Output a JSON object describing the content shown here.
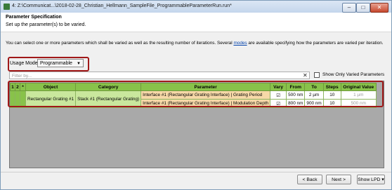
{
  "window": {
    "title": "4: Z:\\Communicat...\\2018-02-28_Christian_Hellmann_SampleFile_ProgrammableParameterRun.run*",
    "controls": {
      "minimize": "–",
      "maximize": "□",
      "close": "✕"
    }
  },
  "header": {
    "title": "Parameter Specification",
    "subtitle": "Set up the parameter(s) to be varied."
  },
  "description": {
    "before": "You can select one or more parameters which shall be varied as well as the resulting number of iterations. Several ",
    "link": "modes",
    "after": " are available specifying how the parameters are varied per iteration."
  },
  "usage_mode": {
    "label": "Usage Mode",
    "value": "Programmable"
  },
  "filter": {
    "placeholder": "Filter by...",
    "clear": "✕"
  },
  "show_only_varied": {
    "label": "Show Only Varied Parameters",
    "checked": false
  },
  "grid": {
    "columns": [
      "1",
      "2",
      "*",
      "Object",
      "Category",
      "Parameter",
      "Vary",
      "From",
      "To",
      "Steps",
      "Original Value"
    ],
    "object": "Rectangular Grating #1",
    "category": "Stack #1 (Rectangular Grating)",
    "rows": [
      {
        "parameter": "Interface #1 (Rectangular Grating Interface) | Grating Period",
        "vary": "☑",
        "from": "500 nm",
        "to": "2 µm",
        "steps": "10",
        "original": "1 µm"
      },
      {
        "parameter": "Interface #1 (Rectangular Grating Interface) | Modulation Depth",
        "vary": "☑",
        "from": "800 nm",
        "to": "900 nm",
        "steps": "10",
        "original": "500 nm"
      }
    ]
  },
  "buttons": {
    "back": "< Back",
    "next": "Next >",
    "show_lpd": "Show  LPD ▾"
  },
  "colors": {
    "highlight": "#a01818",
    "header_green": "#88c24a",
    "cell_green": "#c9e79d",
    "cell_orange": "#f7d9a8"
  }
}
